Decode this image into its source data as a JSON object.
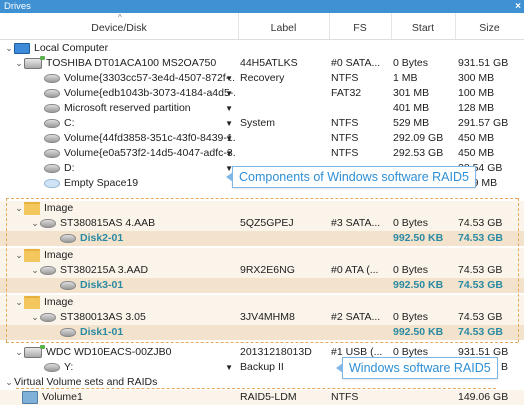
{
  "window": {
    "title": "Drives",
    "close": "×"
  },
  "columns": {
    "device": "Device/Disk",
    "label": "Label",
    "fs": "FS",
    "start": "Start",
    "size": "Size"
  },
  "rows": [
    {
      "name": "Local Computer",
      "label": "",
      "fs": "",
      "start": "",
      "size": ""
    },
    {
      "name": "TOSHIBA DT01ACA100 MS2OA750",
      "label": "44H5ATLKS",
      "fs": "#0 SATA...",
      "start": "0 Bytes",
      "size": "931.51 GB"
    },
    {
      "name": "Volume{3303cc57-3e4d-4507-872f-...",
      "label": "Recovery",
      "fs": "NTFS",
      "start": "1 MB",
      "size": "300 MB"
    },
    {
      "name": "Volume{edb1043b-3073-4184-a4d5-...",
      "label": "",
      "fs": "FAT32",
      "start": "301 MB",
      "size": "100 MB"
    },
    {
      "name": "Microsoft reserved partition",
      "label": "",
      "fs": "",
      "start": "401 MB",
      "size": "128 MB"
    },
    {
      "name": "C:",
      "label": "System",
      "fs": "NTFS",
      "start": "529 MB",
      "size": "291.57 GB"
    },
    {
      "name": "Volume{44fd3858-351c-43f0-8439-1...",
      "label": "",
      "fs": "NTFS",
      "start": "292.09 GB",
      "size": "450 MB"
    },
    {
      "name": "Volume{e0a573f2-14d5-4047-adfc-3...",
      "label": "",
      "fs": "NTFS",
      "start": "292.53 GB",
      "size": "450 MB"
    },
    {
      "name": "D:",
      "label": "",
      "fs": "",
      "start": "",
      "size": "38.54 GB"
    },
    {
      "name": "Empty Space19",
      "label": "",
      "fs": "",
      "start": "931.81 GB",
      "size": "1.69 MB"
    },
    {
      "name": "Image",
      "label": "",
      "fs": "",
      "start": "",
      "size": ""
    },
    {
      "name": "ST380815AS 4.AAB",
      "label": "5QZ5GPEJ",
      "fs": "#3 SATA...",
      "start": "0 Bytes",
      "size": "74.53 GB"
    },
    {
      "name": "Disk2-01",
      "label": "",
      "fs": "",
      "start": "992.50 KB",
      "size": "74.53 GB"
    },
    {
      "name": "Image",
      "label": "",
      "fs": "",
      "start": "",
      "size": ""
    },
    {
      "name": "ST380215A 3.AAD",
      "label": "9RX2E6NG",
      "fs": "#0 ATA (...",
      "start": "0 Bytes",
      "size": "74.53 GB"
    },
    {
      "name": "Disk3-01",
      "label": "",
      "fs": "",
      "start": "992.50 KB",
      "size": "74.53 GB"
    },
    {
      "name": "Image",
      "label": "",
      "fs": "",
      "start": "",
      "size": ""
    },
    {
      "name": "ST380013AS 3.05",
      "label": "3JV4MHM8",
      "fs": "#2 SATA...",
      "start": "0 Bytes",
      "size": "74.53 GB"
    },
    {
      "name": "Disk1-01",
      "label": "",
      "fs": "",
      "start": "992.50 KB",
      "size": "74.53 GB"
    },
    {
      "name": "WDC WD10EACS-00ZJB0",
      "label": "20131218013D",
      "fs": "#1 USB (...",
      "start": "0 Bytes",
      "size": "931.51 GB"
    },
    {
      "name": "Y:",
      "label": "Backup II",
      "fs": "",
      "start": "",
      "size": "B"
    },
    {
      "name": "Virtual Volume sets and RAIDs",
      "label": "",
      "fs": "",
      "start": "",
      "size": ""
    },
    {
      "name": "Volume1",
      "label": "RAID5-LDM",
      "fs": "NTFS",
      "start": "",
      "size": "149.06 GB"
    }
  ],
  "callouts": {
    "components": "Components of Windows software RAID5",
    "raid": "Windows software RAID5"
  }
}
